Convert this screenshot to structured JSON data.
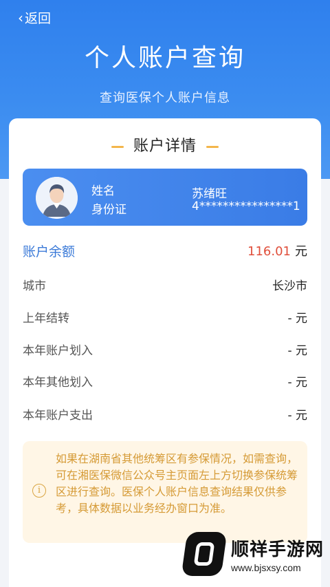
{
  "header": {
    "back_label": "返回",
    "title": "个人账户查询",
    "subtitle": "查询医保个人账户信息"
  },
  "card": {
    "section_title": "账户详情",
    "profile": {
      "name_label": "姓名",
      "id_label": "身份证",
      "name_value": "苏绪旺",
      "id_value": "4****************1"
    },
    "balance": {
      "label": "账户余额",
      "value": "116.01",
      "unit": "元"
    },
    "rows": [
      {
        "label": "城市",
        "value": "长沙市"
      },
      {
        "label": "上年结转",
        "value": "- 元"
      },
      {
        "label": "本年账户划入",
        "value": "- 元"
      },
      {
        "label": "本年其他划入",
        "value": "- 元"
      },
      {
        "label": "本年账户支出",
        "value": "- 元"
      }
    ],
    "notice": "如果在湖南省其他统筹区有参保情况，如需查询，可在湘医保微信公众号主页面左上方切换参保统筹区进行查询。医保个人账户信息查询结果仅供参考，具体数据以业务经办窗口为准。"
  },
  "watermark": {
    "name": "顺祥手游网",
    "url": "www.bjsxsy.com"
  },
  "colors": {
    "header_blue": "#2f80ed",
    "accent_orange": "#f3b64b",
    "balance_red": "#e04f3b",
    "notice_bg": "#fff6e6",
    "notice_text": "#d59a35"
  },
  "icons": [
    "chevron-left-icon",
    "avatar-icon",
    "info-icon"
  ]
}
